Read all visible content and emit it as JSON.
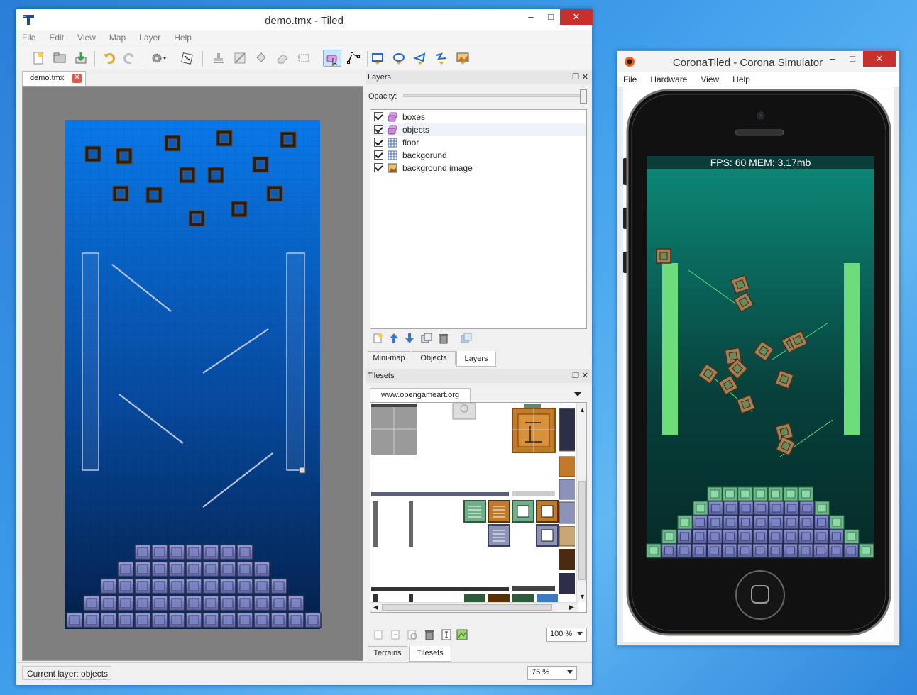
{
  "tiled": {
    "title": "demo.tmx - Tiled",
    "controls": {
      "minimize": "–",
      "maximize": "□",
      "close": "✕"
    },
    "menu": [
      "File",
      "Edit",
      "View",
      "Map",
      "Layer",
      "Help"
    ],
    "doc_tab": "demo.tmx",
    "layers_panel": {
      "title": "Layers",
      "opacity_label": "Opacity:",
      "items": [
        {
          "name": "boxes",
          "icon": "object-layer-icon",
          "checked": true
        },
        {
          "name": "objects",
          "icon": "object-layer-icon",
          "checked": true
        },
        {
          "name": "floor",
          "icon": "tile-layer-icon",
          "checked": true
        },
        {
          "name": "backgorund",
          "icon": "tile-layer-icon",
          "checked": true
        },
        {
          "name": "background image",
          "icon": "image-layer-icon",
          "checked": true
        }
      ],
      "selected": "objects",
      "tabs": [
        "Mini-map",
        "Objects",
        "Layers"
      ],
      "active_tab": "Layers"
    },
    "tilesets_panel": {
      "title": "Tilesets",
      "tileset_tab": "www.opengameart.org",
      "zoom": "100 %",
      "tabs": [
        "Terrains",
        "Tilesets"
      ],
      "active_tab": "Tilesets"
    },
    "status": {
      "current_layer": "Current layer: objects",
      "zoom": "75 %"
    }
  },
  "corona": {
    "title": "CoronaTiled - Corona Simulator",
    "controls": {
      "minimize": "–",
      "maximize": "□",
      "close": "✕"
    },
    "menu": [
      "File",
      "Hardware",
      "View",
      "Help"
    ],
    "hud": "FPS: 60 MEM: 3.17mb"
  },
  "colors": {
    "accent": "#3a83d3",
    "map_top": "#0a78e8",
    "map_bottom": "#051f49",
    "sim_bg_top": "#0d8a7a",
    "sim_bg_bottom": "#052b29",
    "sim_pillar": "#6ddd7a",
    "close_red": "#c7302b"
  }
}
